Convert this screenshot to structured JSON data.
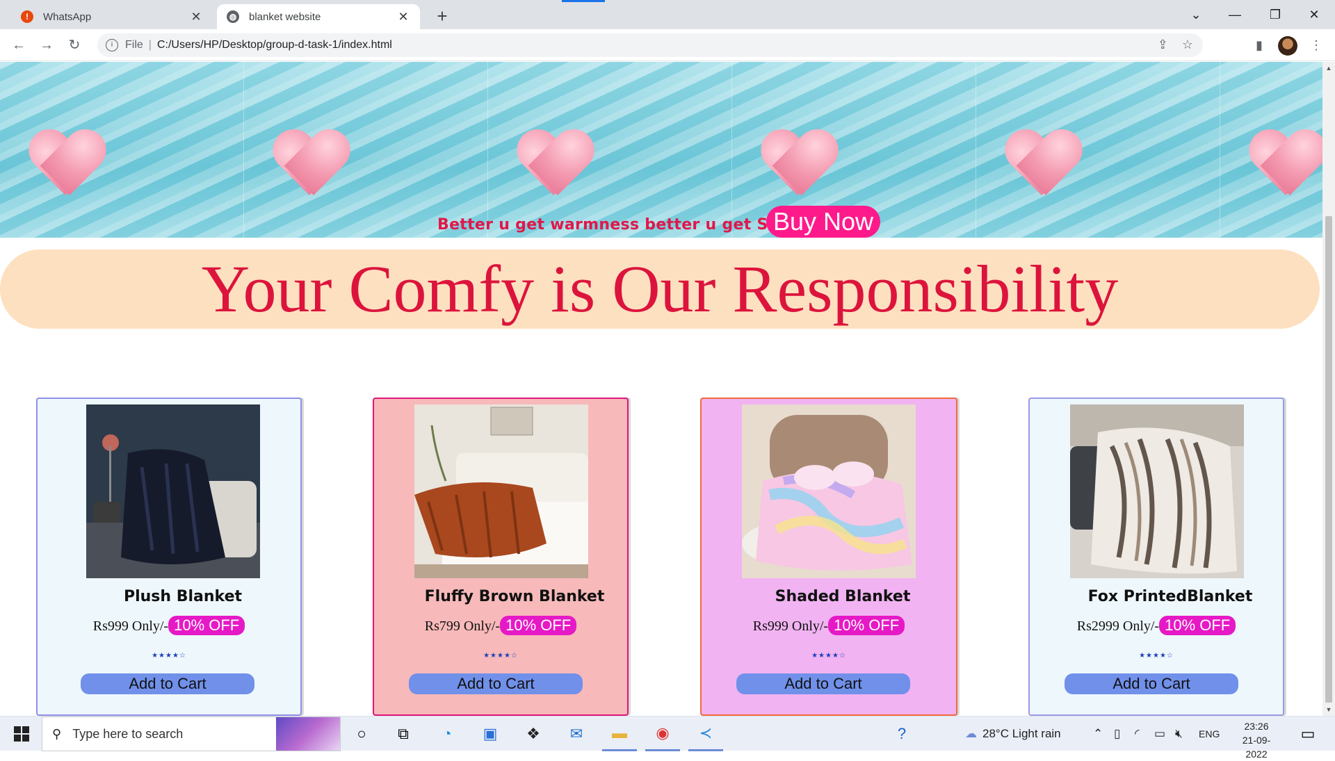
{
  "browser": {
    "tabs": [
      {
        "title": "WhatsApp",
        "favicon": "alert-icon",
        "active": false
      },
      {
        "title": "blanket website",
        "favicon": "globe-icon",
        "active": true
      }
    ],
    "address": {
      "scheme": "File",
      "url": "C:/Users/HP/Desktop/group-d-task-1/index.html"
    }
  },
  "page": {
    "banner": {
      "tagline": "Better u get warmness better u get Sleep",
      "buy_now": "Buy Now"
    },
    "slogan": "Your Comfy is Our Responsibility",
    "products": [
      {
        "name": "Plush Blanket",
        "price": "Rs999 Only/-",
        "discount": "10% OFF",
        "rating": "★★★★☆",
        "button": "Add to Cart",
        "bg": "#eef7fb",
        "border": "#8f8fe6"
      },
      {
        "name": "Fluffy Brown Blanket",
        "price": "Rs799 Only/-",
        "discount": "10% OFF",
        "rating": "★★★★☆",
        "button": "Add to Cart",
        "bg": "#f7b9b9",
        "border": "#e0157a"
      },
      {
        "name": "Shaded Blanket",
        "price": "Rs999 Only/-",
        "discount": "10% OFF",
        "rating": "★★★★☆",
        "button": "Add to Cart",
        "bg": "#f1b3f1",
        "border": "#f06a3a"
      },
      {
        "name": "Fox PrintedBlanket",
        "price": "Rs2999 Only/-",
        "discount": "10% OFF",
        "rating": "★★★★☆",
        "button": "Add to Cart",
        "bg": "#eef7fb",
        "border": "#9a9ae6"
      }
    ]
  },
  "taskbar": {
    "search_placeholder": "Type here to search",
    "weather": "28°C  Light rain",
    "language": "ENG",
    "time": "23:26",
    "date": "21-09-2022"
  },
  "colors": {
    "accent_pink": "#ff1a8c",
    "slogan_red": "#dc143c",
    "slogan_bg": "#fde0c0",
    "cart_button": "#7090ea"
  }
}
